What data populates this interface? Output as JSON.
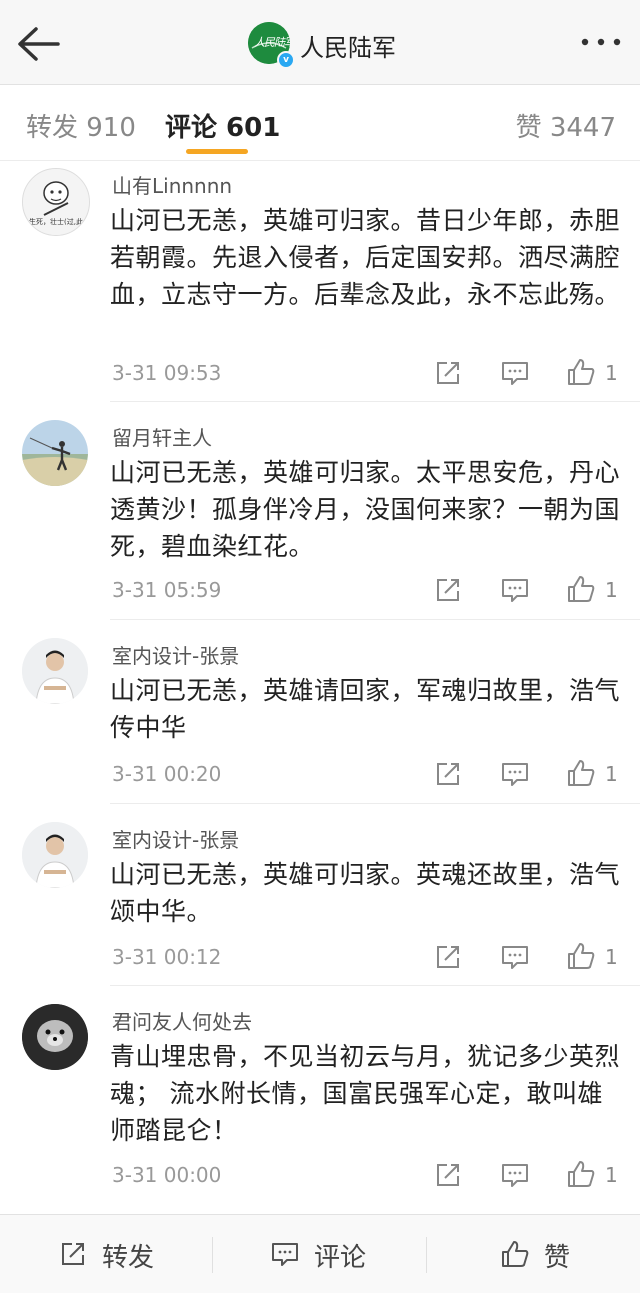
{
  "header": {
    "back_icon": "arrow-left-icon",
    "account_name": "人民陆军",
    "logo_text": "人民陆军",
    "verified_badge": "v",
    "more_icon": "more-dots-icon"
  },
  "tabs": {
    "repost": "转发 910",
    "comments": "评论 601",
    "likes": "赞 3447",
    "active_color": "#f5a623"
  },
  "comments": [
    {
      "name": "山有Linnnnn",
      "text": "山河已无恙，英雄可归家。昔日少年郎，赤胆若朝霞。先退入侵者，后定国安邦。洒尽满腔血，立志守一方。后辈念及此，永不忘此殇。",
      "time": "3-31 09:53",
      "likes": "1",
      "avatar_caption": "生死，壮士(过,此"
    },
    {
      "name": "留月轩主人",
      "text": "山河已无恙，英雄可归家。太平思安危，丹心透黄沙！孤身伴冷月，没国何来家？一朝为国死，碧血染红花。",
      "time": "3-31 05:59",
      "likes": "1"
    },
    {
      "name": "室内设计-张景",
      "text": "山河已无恙，英雄请回家，军魂归故里，浩气传中华",
      "time": "3-31 00:20",
      "likes": "1"
    },
    {
      "name": "室内设计-张景",
      "text": "山河已无恙，英雄可归家。英魂还故里，浩气颂中华。",
      "time": "3-31 00:12",
      "likes": "1"
    },
    {
      "name": "君问友人何处去",
      "text": "青山埋忠骨，不见当初云与月，犹记多少英烈魂； 流水附长情，国富民强军心定，敢叫雄师踏昆仑！",
      "time": "3-31 00:00",
      "likes": "1"
    }
  ],
  "actions": {
    "share_icon": "share-icon",
    "reply_icon": "comment-icon",
    "like_icon": "thumbs-up-icon"
  },
  "bottom_bar": {
    "repost": "转发",
    "comment": "评论",
    "like": "赞"
  }
}
